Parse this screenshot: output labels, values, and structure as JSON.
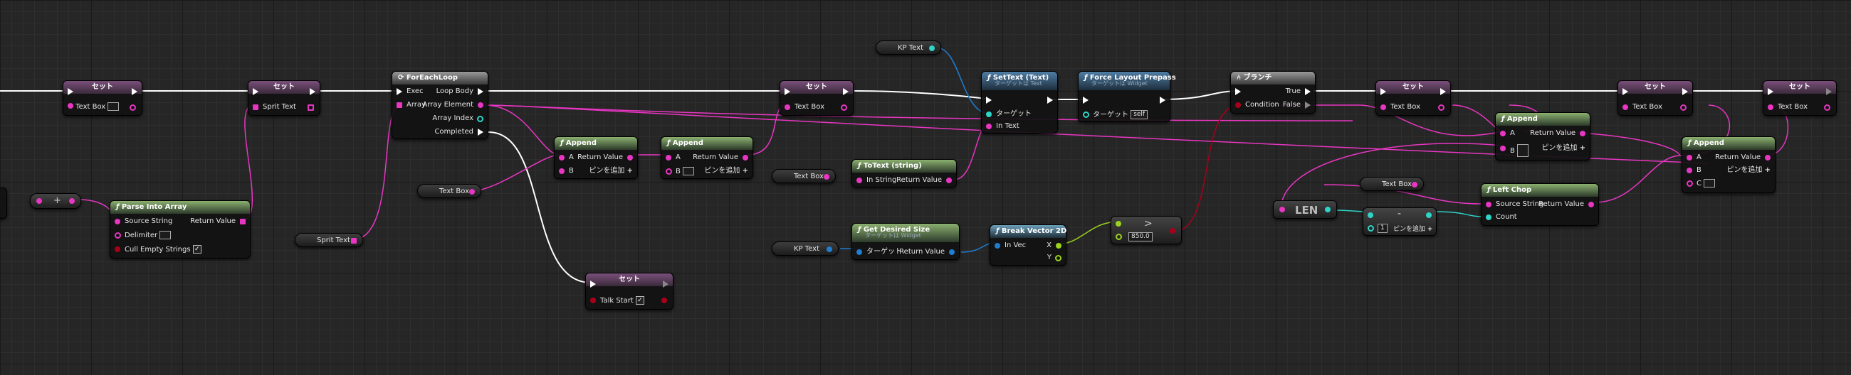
{
  "nodes": {
    "set1": {
      "title": "セット",
      "var": "Text Box"
    },
    "set2": {
      "title": "セット",
      "var": "Sprit Text"
    },
    "foreach": {
      "title": "ForEachLoop",
      "exec": "Exec",
      "array": "Array",
      "loop_body": "Loop Body",
      "array_element": "Array Element",
      "array_index": "Array Index",
      "completed": "Completed"
    },
    "set3": {
      "title": "セット",
      "var": "Text Box"
    },
    "append1": {
      "title": "Append",
      "a": "A",
      "b": "B",
      "return": "Return Value",
      "add_pin": "ピンを追加"
    },
    "append2": {
      "title": "Append",
      "a": "A",
      "b": "B",
      "return": "Return Value",
      "add_pin": "ピンを追加"
    },
    "settext": {
      "title": "SetText (Text)",
      "subtitle": "ターゲットは Text",
      "target": "ターゲット",
      "in_text": "In Text"
    },
    "force_layout": {
      "title": "Force Layout Prepass",
      "subtitle": "ターゲットは Widget",
      "target": "ターゲット",
      "self": "self"
    },
    "totext": {
      "title": "ToText (string)",
      "in_string": "In String",
      "return": "Return Value"
    },
    "desired_size": {
      "title": "Get Desired Size",
      "subtitle": "ターゲットは Widget",
      "target": "ターゲット",
      "return": "Return Value"
    },
    "break_vec": {
      "title": "Break Vector 2D",
      "in_vec": "In Vec",
      "x": "X",
      "y": "Y"
    },
    "compare": {
      "symbol": ">",
      "value": "850.0"
    },
    "branch": {
      "title": "ブランチ",
      "condition": "Condition",
      "true": "True",
      "false": "False"
    },
    "set4": {
      "title": "セット",
      "var": "Text Box"
    },
    "append3": {
      "title": "Append",
      "a": "A",
      "b": "B",
      "return": "Return Value",
      "add_pin": "ピンを追加"
    },
    "set5": {
      "title": "セット",
      "var": "Text Box"
    },
    "append4": {
      "title": "Append",
      "a": "A",
      "b": "B",
      "c": "C",
      "return": "Return Value",
      "add_pin": "ピンを追加"
    },
    "set6": {
      "title": "セット",
      "var": "Text Box"
    },
    "len": {
      "title": "LEN"
    },
    "minus": {
      "symbol": "-",
      "value": "1",
      "add_pin": "ピンを追加"
    },
    "left_chop": {
      "title": "Left Chop",
      "source": "Source String",
      "count": "Count",
      "return": "Return Value"
    },
    "parse": {
      "title": "Parse Into Array",
      "source": "Source String",
      "delimiter": "Delimiter",
      "cull": "Cull Empty Strings",
      "return": "Return Value"
    },
    "plus": {
      "symbol": "+"
    },
    "set_talk": {
      "title": "セット",
      "var": "Talk Start"
    }
  },
  "getters": {
    "kp_text_top": "KP Text",
    "sprit_text": "Sprit Text",
    "text_box_mid": "Text Box",
    "text_box_left": "Text Box",
    "kp_text_bottom": "KP Text",
    "text_box_right": "Text Box"
  },
  "colors": {
    "string_pin": "#e836c2",
    "bool_pin": "#a8001a",
    "int_pin": "#2dd4c8",
    "object_pin": "#1f7ed0",
    "vector2d_pin": "#9bd21e",
    "exec_pin": "#ffffff",
    "background": "#262626"
  }
}
